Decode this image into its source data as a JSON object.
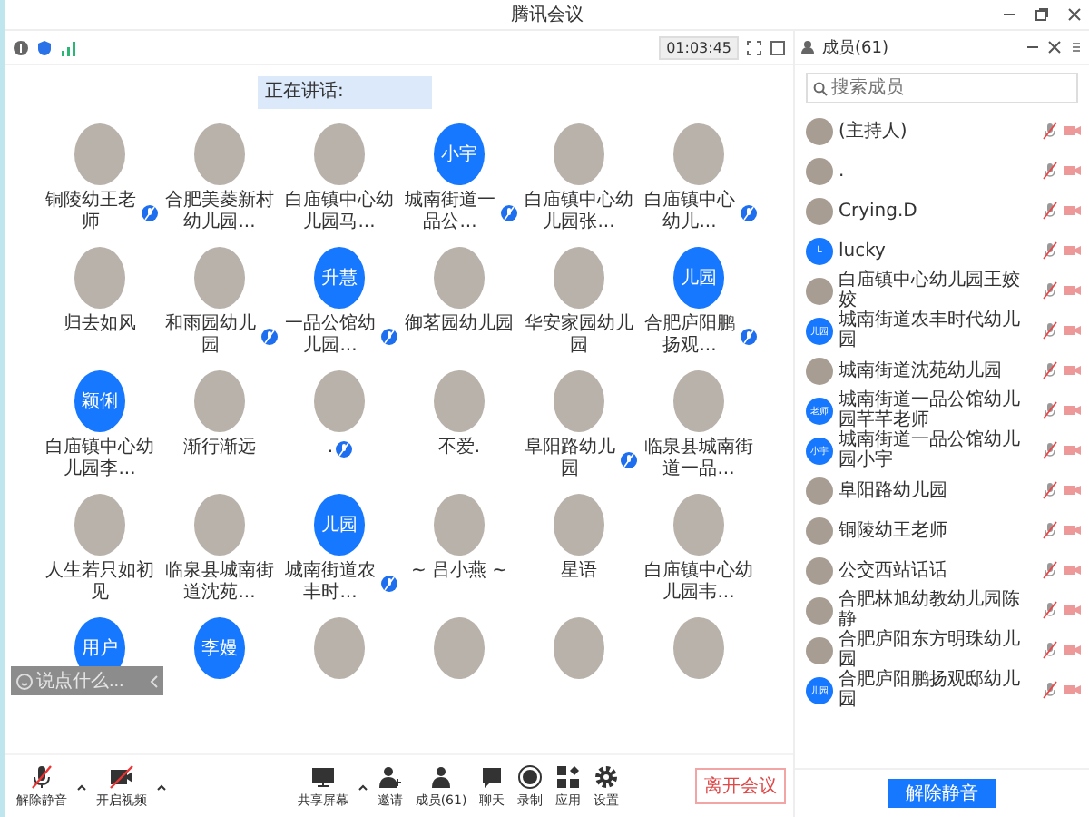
{
  "window": {
    "title": "腾讯会议"
  },
  "timer": "01:03:45",
  "speaking": {
    "label": "正在讲话:"
  },
  "participants": [
    {
      "name": "铜陵幼王老师",
      "avatar": {
        "kind": "photo"
      },
      "muted": true
    },
    {
      "name": "合肥美菱新村幼儿园...",
      "avatar": {
        "kind": "photo"
      },
      "muted": false
    },
    {
      "name": "白庙镇中心幼儿园马...",
      "avatar": {
        "kind": "photo"
      },
      "muted": false
    },
    {
      "name": "城南街道一品公...",
      "avatar": {
        "kind": "text",
        "text": "小宇"
      },
      "muted": true
    },
    {
      "name": "白庙镇中心幼儿园张...",
      "avatar": {
        "kind": "photo"
      },
      "muted": false
    },
    {
      "name": "白庙镇中心幼儿...",
      "avatar": {
        "kind": "photo"
      },
      "muted": true
    },
    {
      "name": "归去如风",
      "avatar": {
        "kind": "photo"
      },
      "muted": false
    },
    {
      "name": "和雨园幼儿园",
      "avatar": {
        "kind": "photo"
      },
      "muted": true
    },
    {
      "name": "一品公馆幼儿园...",
      "avatar": {
        "kind": "text",
        "text": "升慧"
      },
      "muted": true
    },
    {
      "name": "御茗园幼儿园",
      "avatar": {
        "kind": "photo"
      },
      "muted": false
    },
    {
      "name": "华安家园幼儿园",
      "avatar": {
        "kind": "photo"
      },
      "muted": false
    },
    {
      "name": "合肥庐阳鹏扬观...",
      "avatar": {
        "kind": "text",
        "text": "儿园"
      },
      "muted": true
    },
    {
      "name": "白庙镇中心幼儿园李...",
      "avatar": {
        "kind": "text",
        "text": "颖俐"
      },
      "muted": false
    },
    {
      "name": "渐行渐远",
      "avatar": {
        "kind": "photo"
      },
      "muted": false
    },
    {
      "name": ".",
      "avatar": {
        "kind": "photo"
      },
      "muted": true
    },
    {
      "name": "不爱.",
      "avatar": {
        "kind": "photo"
      },
      "muted": false
    },
    {
      "name": "阜阳路幼儿园",
      "avatar": {
        "kind": "photo"
      },
      "muted": true
    },
    {
      "name": "临泉县城南街道一品...",
      "avatar": {
        "kind": "photo"
      },
      "muted": false
    },
    {
      "name": "人生若只如初见",
      "avatar": {
        "kind": "photo"
      },
      "muted": false
    },
    {
      "name": "临泉县城南街道沈苑...",
      "avatar": {
        "kind": "photo"
      },
      "muted": false
    },
    {
      "name": "城南街道农丰时...",
      "avatar": {
        "kind": "text",
        "text": "儿园"
      },
      "muted": true
    },
    {
      "name": "~ 吕小燕 ~",
      "avatar": {
        "kind": "photo"
      },
      "muted": false
    },
    {
      "name": "星语",
      "avatar": {
        "kind": "photo"
      },
      "muted": false
    },
    {
      "name": "白庙镇中心幼儿园韦...",
      "avatar": {
        "kind": "photo"
      },
      "muted": false
    },
    {
      "avatar": {
        "kind": "text",
        "text": "用户"
      },
      "muted": false
    },
    {
      "avatar": {
        "kind": "text",
        "text": "李嫚"
      },
      "muted": false
    },
    {
      "avatar": {
        "kind": "photo"
      },
      "muted": false
    },
    {
      "avatar": {
        "kind": "photo"
      },
      "muted": false
    },
    {
      "avatar": {
        "kind": "photo"
      },
      "muted": false
    },
    {
      "avatar": {
        "kind": "photo"
      },
      "muted": false
    }
  ],
  "chat": {
    "placeholder": "说点什么..."
  },
  "toolbar": {
    "audio": {
      "label": "解除静音",
      "muted": true
    },
    "video": {
      "label": "开启视频",
      "on": false
    },
    "tools": [
      "共享屏幕",
      "邀请",
      "成员(61)",
      "聊天",
      "录制",
      "应用",
      "设置"
    ],
    "leave": "离开会议"
  },
  "members_panel": {
    "title": "成员(61)",
    "search": {
      "placeholder": "搜索成员"
    },
    "members": [
      {
        "name": "(主持人)",
        "avatar": {
          "kind": "photo"
        },
        "muted": true
      },
      {
        "name": ".",
        "avatar": {
          "kind": "photo"
        },
        "muted": true
      },
      {
        "name": "Crying.D",
        "avatar": {
          "kind": "photo"
        },
        "muted": true
      },
      {
        "name": "lucky",
        "avatar": {
          "kind": "text",
          "text": "L"
        },
        "muted": true
      },
      {
        "name": "白庙镇中心幼儿园王姣姣",
        "avatar": {
          "kind": "photo"
        },
        "muted": true
      },
      {
        "name": "城南街道农丰时代幼儿园",
        "avatar": {
          "kind": "text",
          "text": "儿园"
        },
        "muted": true
      },
      {
        "name": "城南街道沈苑幼儿园",
        "avatar": {
          "kind": "photo"
        },
        "muted": true
      },
      {
        "name": "城南街道一品公馆幼儿园芊芊老师",
        "avatar": {
          "kind": "text",
          "text": "老师"
        },
        "muted": true
      },
      {
        "name": "城南街道一品公馆幼儿园小宇",
        "avatar": {
          "kind": "text",
          "text": "小宇"
        },
        "muted": true
      },
      {
        "name": "阜阳路幼儿园",
        "avatar": {
          "kind": "photo"
        },
        "muted": true
      },
      {
        "name": "铜陵幼王老师",
        "avatar": {
          "kind": "photo"
        },
        "muted": true
      },
      {
        "name": "公交西站话话",
        "avatar": {
          "kind": "photo"
        },
        "muted": true
      },
      {
        "name": "合肥林旭幼教幼儿园陈静",
        "avatar": {
          "kind": "photo"
        },
        "muted": true
      },
      {
        "name": "合肥庐阳东方明珠幼儿园",
        "avatar": {
          "kind": "photo"
        },
        "muted": true
      },
      {
        "name": "合肥庐阳鹏扬观邸幼儿园",
        "avatar": {
          "kind": "text",
          "text": "儿园"
        },
        "muted": true
      }
    ],
    "button": "解除静音"
  }
}
